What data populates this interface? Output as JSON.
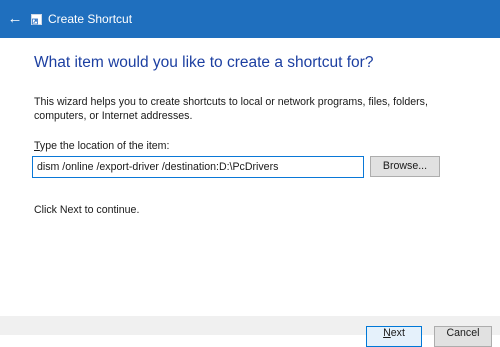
{
  "window": {
    "title": "Create Shortcut",
    "back_icon": "arrow-left-icon",
    "title_icon": "shortcut-icon",
    "titlebar_color": "#1f6fbe"
  },
  "main": {
    "heading": "What item would you like to create a shortcut for?",
    "description": "This wizard helps you to create shortcuts to local or network programs, files, folders, computers, or Internet addresses.",
    "field_label_first": "T",
    "field_label_rest": "ype the location of the item:",
    "location_value": "dism /online /export-driver /destination:D:\\PcDrivers",
    "browse_label_first": "Browse",
    "browse_label_rest": "...",
    "continue_text": "Click Next to continue.",
    "heading_color": "#1c3fa1",
    "input_focus_color": "#0a78d7"
  },
  "footer": {
    "next_label_first": "N",
    "next_label_rest": "ext",
    "cancel_label": "Cancel"
  }
}
